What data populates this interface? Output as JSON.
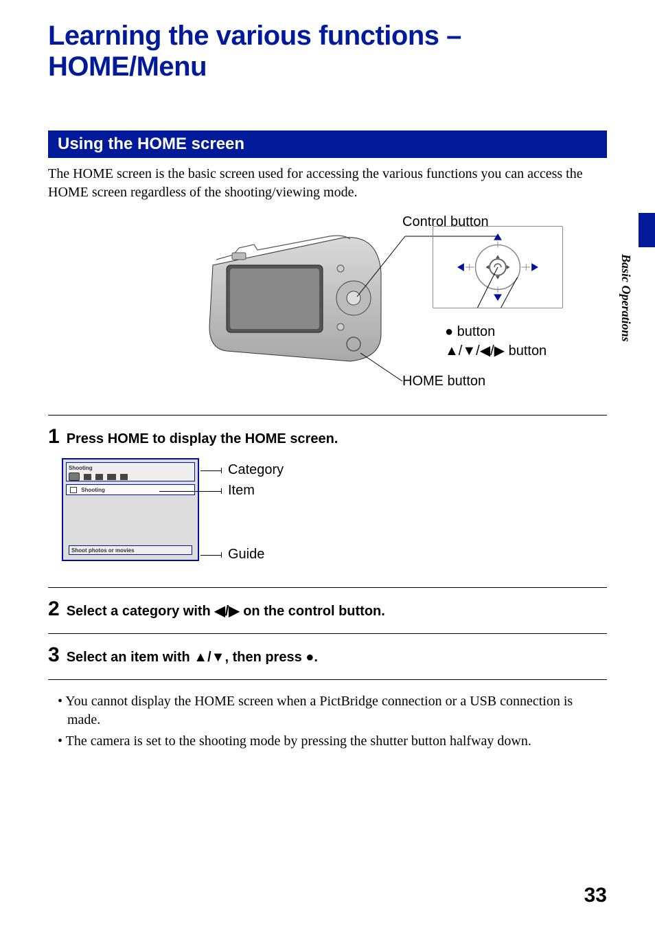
{
  "title": "Learning the various functions – HOME/Menu",
  "section": {
    "heading": "Using the HOME screen"
  },
  "intro": "The HOME screen is the basic screen used for accessing the various functions you can access the HOME screen regardless of the shooting/viewing mode.",
  "diagram": {
    "control_button": "Control button",
    "center_button": "● button",
    "dpad_button": "▲/▼/◀/▶ button",
    "home_button": "HOME button"
  },
  "steps": {
    "s1": {
      "num": "1",
      "text": "Press HOME to display the HOME screen."
    },
    "s2": {
      "num": "2",
      "text_before": "Select a category with ",
      "arrows": "◀/▶",
      "text_after": " on the control button."
    },
    "s3": {
      "num": "3",
      "text_before": "Select an item with ",
      "updown": "▲/▼",
      "text_mid": ", then press ",
      "dot": "●",
      "text_after": "."
    }
  },
  "lcd": {
    "cat_label": "Shooting",
    "item_label": "Shooting",
    "guide_label": "Shoot photos or movies",
    "callout_category": "Category",
    "callout_item": "Item",
    "callout_guide": "Guide"
  },
  "bullets": {
    "b1": "You cannot display the HOME screen when a PictBridge connection or a USB connection is made.",
    "b2": "The camera is set to the shooting mode by pressing the shutter button halfway down."
  },
  "side_label": "Basic Operations",
  "page_number": "33"
}
